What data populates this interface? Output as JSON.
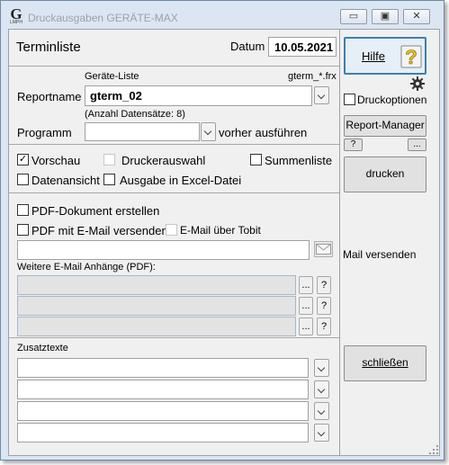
{
  "window": {
    "title": "Druckausgaben  GERÄTE-MAX",
    "logo_letter": "G",
    "logo_sub": "LMPH",
    "minimize_glyph": "▭",
    "maximize_glyph": "▣",
    "close_glyph": "✕"
  },
  "header": {
    "title": "Terminliste",
    "date_label": "Datum",
    "date_value": "10.05.2021"
  },
  "report": {
    "list_caption": "Geräte-Liste",
    "file_pattern": "gterm_*.frx",
    "reportname_label": "Reportname",
    "reportname_value": "gterm_02",
    "record_count": "(Anzahl Datensätze: 8)",
    "programm_label": "Programm",
    "programm_value": "",
    "vorher_label": "vorher ausführen"
  },
  "options": {
    "vorschau": {
      "label": "Vorschau",
      "checked": true
    },
    "druckerauswahl": {
      "label": "Druckerauswahl",
      "checked": false
    },
    "summenliste": {
      "label": "Summenliste",
      "checked": false
    },
    "datenansicht": {
      "label": "Datenansicht",
      "checked": false
    },
    "excel": {
      "label": "Ausgabe in Excel-Datei",
      "checked": false
    }
  },
  "pdf": {
    "create_label": "PDF-Dokument erstellen",
    "email_label": "PDF mit E-Mail versenden!",
    "tobit_label": "E-Mail über Tobit",
    "email_value": "",
    "attachments_label": "Weitere E-Mail Anhänge (PDF):",
    "browse_label": "...",
    "help_label": "?"
  },
  "zusatz": {
    "label": "Zusatztexte"
  },
  "sidebar": {
    "hilfe_label": "Hilfe",
    "druckoptionen_label": "Druckoptionen",
    "report_manager_label": "Report-Manager",
    "small_help": "?",
    "small_more": "...",
    "drucken_label": "drucken",
    "mail_label": "Mail versenden",
    "schliessen_label": "schließen"
  },
  "colors": {
    "window_frame": "#dbe6f2",
    "client_bg": "#f0f0f0",
    "focus_border": "#3c7fb1"
  }
}
